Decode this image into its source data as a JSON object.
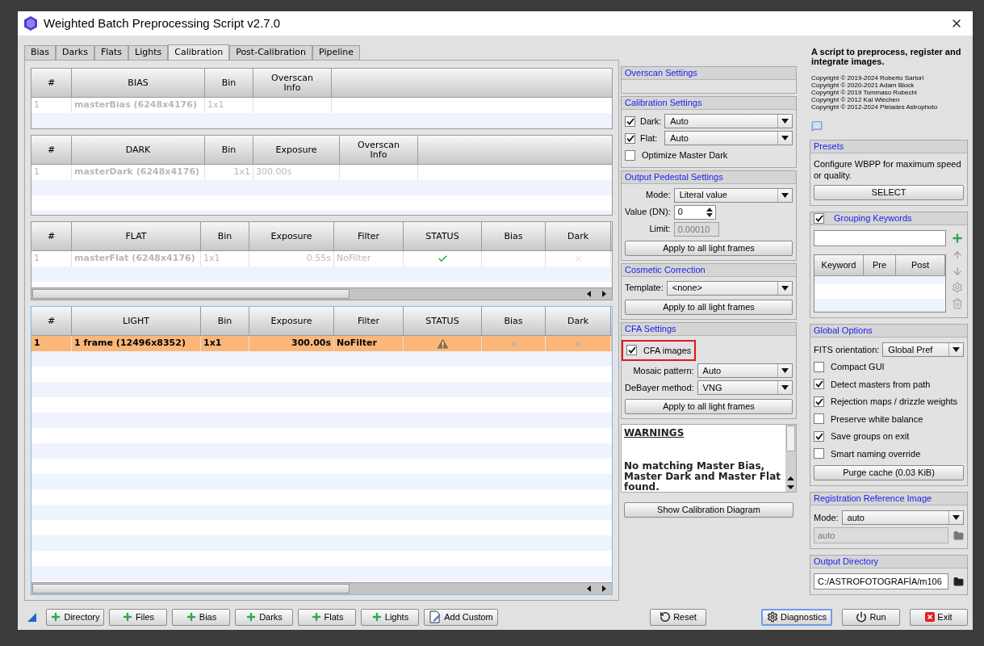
{
  "window": {
    "title": "Weighted Batch Preprocessing Script v2.7.0"
  },
  "tabs": [
    {
      "label": "Bias",
      "selected": false
    },
    {
      "label": "Darks",
      "selected": false
    },
    {
      "label": "Flats",
      "selected": false
    },
    {
      "label": "Lights",
      "selected": false
    },
    {
      "label": "Calibration",
      "selected": true
    },
    {
      "label": "Post-Calibration",
      "selected": false
    },
    {
      "label": "Pipeline",
      "selected": false
    }
  ],
  "tables": [
    {
      "focused": false,
      "horizontal_scrollbar": false,
      "columns": [
        "#",
        "BIAS",
        "Bin",
        "Overscan Info"
      ],
      "rows": [
        {
          "selected": false,
          "disabled": true,
          "cells": [
            {
              "kind": "text",
              "text": "1"
            },
            {
              "kind": "text",
              "text": "masterBias (6248x4176)"
            },
            {
              "kind": "text",
              "text": "1x1"
            },
            {
              "kind": "empty"
            }
          ]
        }
      ]
    },
    {
      "focused": false,
      "horizontal_scrollbar": false,
      "columns": [
        "#",
        "DARK",
        "Bin",
        "Exposure",
        "Overscan Info"
      ],
      "rows": [
        {
          "selected": false,
          "disabled": true,
          "cells": [
            {
              "kind": "text",
              "text": "1"
            },
            {
              "kind": "text",
              "text": "masterDark (6248x4176)"
            },
            {
              "kind": "num",
              "text": "1x1"
            },
            {
              "kind": "text",
              "text": "300.00s"
            },
            {
              "kind": "empty"
            }
          ]
        }
      ]
    },
    {
      "focused": false,
      "horizontal_scrollbar": true,
      "columns": [
        "#",
        "FLAT",
        "Bin",
        "Exposure",
        "Filter",
        "STATUS",
        "Bias",
        "Dark"
      ],
      "rows": [
        {
          "selected": false,
          "disabled": true,
          "cells": [
            {
              "kind": "text",
              "text": "1"
            },
            {
              "kind": "text",
              "text": "masterFlat (6248x4176)"
            },
            {
              "kind": "text",
              "text": "1x1"
            },
            {
              "kind": "num",
              "text": "0.55s"
            },
            {
              "kind": "text",
              "text": "NoFilter"
            },
            {
              "kind": "check"
            },
            {
              "kind": "empty"
            },
            {
              "kind": "cross"
            }
          ]
        }
      ]
    },
    {
      "focused": true,
      "horizontal_scrollbar": true,
      "columns": [
        "#",
        "LIGHT",
        "Bin",
        "Exposure",
        "Filter",
        "STATUS",
        "Bias",
        "Dark"
      ],
      "rows": [
        {
          "selected": true,
          "disabled": false,
          "cells": [
            {
              "kind": "text",
              "text": "1"
            },
            {
              "kind": "text",
              "text": "1 frame (12496x8352)"
            },
            {
              "kind": "text",
              "text": "1x1"
            },
            {
              "kind": "num",
              "text": "300.00s"
            },
            {
              "kind": "text",
              "text": "NoFilter"
            },
            {
              "kind": "warning"
            },
            {
              "kind": "cross"
            },
            {
              "kind": "cross"
            }
          ]
        }
      ]
    }
  ],
  "middle_sections": [
    {
      "title": "Overscan Settings"
    },
    {
      "title": "Calibration Settings",
      "items": [
        {
          "kind": "check_combo",
          "label": "Dark:",
          "checked": true,
          "value": "Auto"
        },
        {
          "kind": "check_combo",
          "label": "Flat:",
          "checked": true,
          "value": "Auto"
        },
        {
          "kind": "checkbox",
          "label": "Optimize Master Dark",
          "checked": false,
          "highlighted": false
        }
      ]
    },
    {
      "title": "Output Pedestal Settings",
      "items": [
        {
          "kind": "combo",
          "label": "Mode:",
          "value": "Literal value"
        },
        {
          "kind": "spin",
          "label": "Value (DN):",
          "value": "0"
        },
        {
          "kind": "field",
          "label": "Limit:",
          "value": "0.00010",
          "disabled": true
        },
        {
          "kind": "button",
          "label": "Apply to all light frames"
        }
      ]
    },
    {
      "title": "Cosmetic Correction",
      "items": [
        {
          "kind": "combo",
          "label": "Template:",
          "value": "<none>"
        },
        {
          "kind": "button",
          "label": "Apply to all light frames"
        }
      ]
    },
    {
      "title": "CFA Settings",
      "items": [
        {
          "kind": "checkbox",
          "label": "CFA images",
          "checked": true,
          "highlighted": true
        },
        {
          "kind": "combo",
          "label": "Mosaic pattern:",
          "value": "Auto"
        },
        {
          "kind": "combo",
          "label": "DeBayer method:",
          "value": "VNG"
        },
        {
          "kind": "button",
          "label": "Apply to all light frames"
        }
      ]
    }
  ],
  "warnings": {
    "title": "WARNINGS",
    "message": "No matching Master Bias, Master Dark and Master Flat found."
  },
  "diagram_button": "Show Calibration Diagram",
  "about": {
    "description": "A script to preprocess, register and integrate images.",
    "copyrights": [
      "Copyright © 2019-2024 Roberto Sartori",
      "Copyright © 2020-2021 Adam Block",
      "Copyright © 2019 Tommaso Rubechi",
      "Copyright © 2012 Kai Wiechen",
      "Copyright © 2012-2024 Pleiades Astrophoto"
    ]
  },
  "right_sections": [
    {
      "title": "Presets",
      "items": [
        {
          "kind": "text",
          "text": "Configure WBPP for maximum speed or quality."
        },
        {
          "kind": "button",
          "label": "SELECT"
        }
      ]
    },
    {
      "title": "Grouping Keywords",
      "checked": true,
      "items": [
        {
          "kind": "keyword_editor",
          "columns": [
            "Keyword",
            "Pre",
            "Post"
          ]
        }
      ]
    },
    {
      "title": "Global Options",
      "items": [
        {
          "kind": "combo",
          "label": "FITS orientation:",
          "value": "Global Pref"
        },
        {
          "kind": "checkbox",
          "label": "Compact GUI",
          "checked": false,
          "highlighted": false
        },
        {
          "kind": "checkbox",
          "label": "Detect masters from path",
          "checked": true,
          "highlighted": false
        },
        {
          "kind": "checkbox",
          "label": "Rejection maps / drizzle weights",
          "checked": true,
          "highlighted": false
        },
        {
          "kind": "checkbox",
          "label": "Preserve white balance",
          "checked": false,
          "highlighted": false
        },
        {
          "kind": "checkbox",
          "label": "Save groups on exit",
          "checked": true,
          "highlighted": false
        },
        {
          "kind": "checkbox",
          "label": "Smart naming override",
          "checked": false,
          "highlighted": false
        },
        {
          "kind": "button",
          "label": "Purge cache (0.03 KiB)"
        }
      ]
    },
    {
      "title": "Registration Reference Image",
      "items": [
        {
          "kind": "combo",
          "label": "Mode:",
          "value": "auto"
        },
        {
          "kind": "path",
          "value": "auto",
          "disabled": true
        }
      ]
    },
    {
      "title": "Output Directory",
      "items": [
        {
          "kind": "path",
          "value": "C:/ASTROFOTOGRAFÍA/m106",
          "disabled": false
        }
      ]
    }
  ],
  "toolbar": [
    {
      "kind": "add",
      "label": "Directory",
      "focused": false
    },
    {
      "kind": "add",
      "label": "Files",
      "focused": false
    },
    {
      "kind": "add",
      "label": "Bias",
      "focused": false
    },
    {
      "kind": "add",
      "label": "Darks",
      "focused": false
    },
    {
      "kind": "add",
      "label": "Flats",
      "focused": false
    },
    {
      "kind": "add",
      "label": "Lights",
      "focused": false
    },
    {
      "kind": "custom",
      "label": "Add Custom",
      "focused": false
    }
  ],
  "actions": [
    {
      "kind": "reset",
      "label": "Reset",
      "focused": false
    },
    {
      "kind": "diagnostics",
      "label": "Diagnostics",
      "focused": true
    },
    {
      "kind": "run",
      "label": "Run",
      "focused": false
    },
    {
      "kind": "exit",
      "label": "Exit",
      "focused": false
    }
  ]
}
